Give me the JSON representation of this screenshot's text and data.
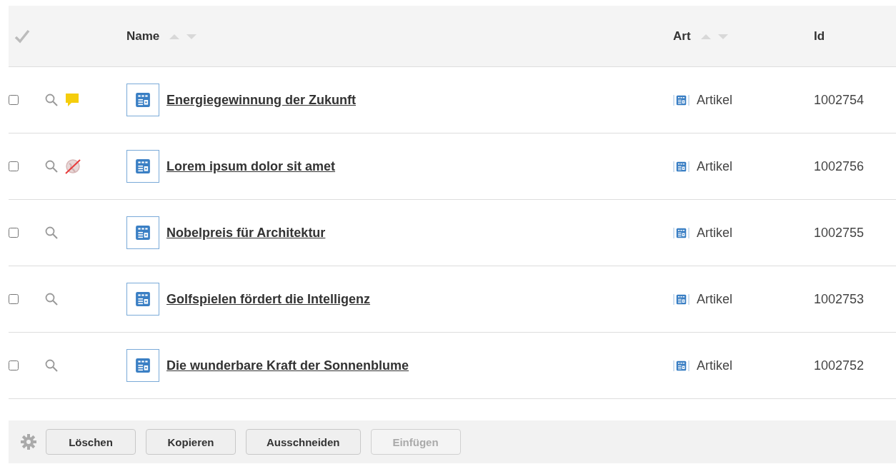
{
  "table": {
    "columns": [
      {
        "label": "Name",
        "sortable": true
      },
      {
        "label": "Art",
        "sortable": true
      },
      {
        "label": "Id",
        "sortable": false
      }
    ],
    "rows": [
      {
        "checked": false,
        "kind": "commented",
        "name": "Energiegewinnung der Zukunft",
        "type": "Artikel",
        "id": "1002754"
      },
      {
        "checked": false,
        "kind": "offline",
        "name": "Lorem ipsum dolor sit amet",
        "type": "Artikel",
        "id": "1002756"
      },
      {
        "checked": false,
        "kind": "plain",
        "name": "Nobelpreis für Architektur",
        "type": "Artikel",
        "id": "1002755"
      },
      {
        "checked": false,
        "kind": "plain",
        "name": "Golfspielen fördert die Intelligenz",
        "type": "Artikel",
        "id": "1002753"
      },
      {
        "checked": false,
        "kind": "plain",
        "name": "Die wunderbare Kraft der Sonnenblume",
        "type": "Artikel",
        "id": "1002752"
      }
    ]
  },
  "toolbar": {
    "buttons": [
      {
        "label": "Löschen",
        "disabled": false
      },
      {
        "label": "Kopieren",
        "disabled": false
      },
      {
        "label": "Ausschneiden",
        "disabled": false
      },
      {
        "label": "Einfügen",
        "disabled": true
      }
    ]
  }
}
